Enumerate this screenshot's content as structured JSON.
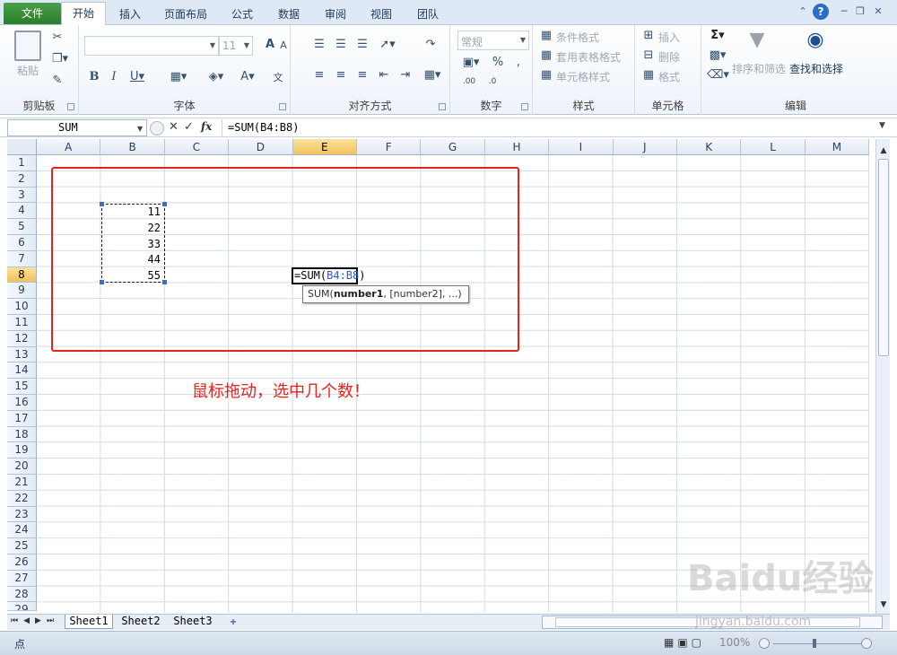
{
  "tabs": [
    "文件",
    "开始",
    "插入",
    "页面布局",
    "公式",
    "数据",
    "审阅",
    "视图",
    "团队"
  ],
  "ribbon": {
    "clipboard": {
      "label": "剪贴板",
      "paste": "粘贴"
    },
    "font": {
      "label": "字体",
      "size": "11"
    },
    "alignment": {
      "label": "对齐方式"
    },
    "number": {
      "label": "数字",
      "format": "常规"
    },
    "styles": {
      "label": "样式",
      "conditional": "条件格式",
      "table": "套用表格格式",
      "cell": "单元格样式"
    },
    "cells": {
      "label": "单元格",
      "insert": "插入",
      "delete": "删除",
      "format": "格式"
    },
    "editing": {
      "label": "编辑",
      "sort": "排序和筛选",
      "find": "查找和选择"
    }
  },
  "formula_bar": {
    "name_box": "SUM",
    "fx": "fx",
    "formula": "=SUM(B4:B8)"
  },
  "columns": [
    "A",
    "B",
    "C",
    "D",
    "E",
    "F",
    "G",
    "H",
    "I",
    "J",
    "K",
    "L",
    "M"
  ],
  "rows": [
    "1",
    "2",
    "3",
    "4",
    "5",
    "6",
    "7",
    "8",
    "9",
    "10",
    "11",
    "12",
    "13",
    "14",
    "15",
    "16",
    "17",
    "18",
    "19",
    "20",
    "21",
    "22",
    "23",
    "24",
    "25",
    "26",
    "27",
    "28",
    "29"
  ],
  "cells": {
    "b_values": [
      "11",
      "22",
      "33",
      "44",
      "55"
    ],
    "edit_prefix": "=SUM(",
    "edit_ref": "B4:B8",
    "edit_suffix": ")"
  },
  "tooltip": {
    "fn": "SUM(",
    "arg1": "number1",
    "rest": ", [number2], ...)"
  },
  "annotation": "鼠标拖动，选中几个数！",
  "sheets": [
    "Sheet1",
    "Sheet2",
    "Sheet3"
  ],
  "status": {
    "mode": "点",
    "zoom": "100%"
  },
  "watermark": {
    "logo": "Baidu经验",
    "url": "jingyan.baidu.com"
  }
}
